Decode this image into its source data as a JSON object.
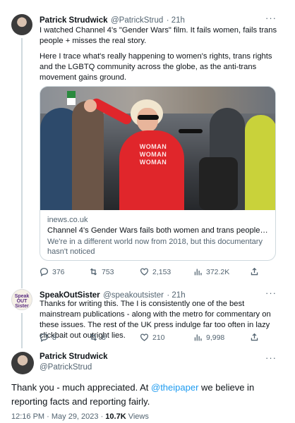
{
  "tweet1": {
    "author_name": "Patrick Strudwick",
    "author_handle": "@PatrickStrud",
    "time": "· 21h",
    "text_p1": "I watched Channel 4's \"Gender Wars\" film. It fails women, fails trans people + misses the real story.",
    "text_p2": "Here I trace what's really happening to women's rights, trans rights and the LGBTQ community across the globe, as the anti-trans movement gains ground.",
    "card": {
      "shirt_text": "WOMAN WOMAN WOMAN",
      "domain": "inews.co.uk",
      "title": "Channel 4's Gender Wars fails both women and trans people – while ...",
      "description": "We're in a different world now from 2018, but this documentary hasn't noticed"
    },
    "actions": {
      "replies": "376",
      "retweets": "753",
      "likes": "2,153",
      "views": "372.2K"
    }
  },
  "tweet2": {
    "author_name": "SpeakOutSister",
    "author_handle": "@speakoutsister",
    "time": "· 21h",
    "avatar_text": "Speak OUT Sister",
    "text": "Thanks for writing this. The I is consistently one of the best mainstream publications - along with the metro for commentary on these issues. The rest of the UK press indulge far too often in lazy clickbait out outright lies.",
    "actions": {
      "replies": "8",
      "retweets": "8",
      "likes": "210",
      "views": "9,998"
    }
  },
  "tweet3": {
    "author_name": "Patrick Strudwick",
    "author_handle": "@PatrickStrud",
    "text_before": "Thank you - much appreciated. At ",
    "mention": "@theipaper",
    "text_after": " we believe in reporting facts and reporting fairly.",
    "timestamp": "12:16 PM · May 29, 2023 · ",
    "views_count": "10.7K",
    "views_label": " Views"
  },
  "more_label": "···",
  "colors": {
    "accent": "#1d9bf0",
    "muted": "#536471",
    "dress": "#e0262b"
  }
}
